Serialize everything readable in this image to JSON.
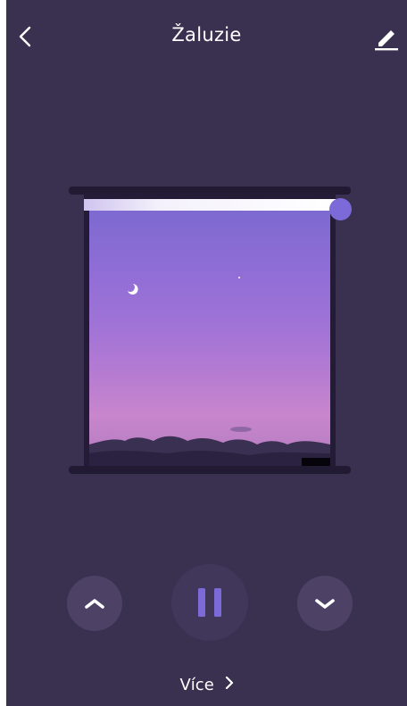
{
  "header": {
    "title": "Žaluzie"
  },
  "blind": {
    "position_fraction_closed": 0.05
  },
  "footer": {
    "more_label": "Více"
  },
  "icons": {
    "back": "chevron-left-icon",
    "edit": "pencil-icon",
    "up": "chevron-up-icon",
    "pause": "pause-icon",
    "down": "chevron-down-icon",
    "more": "chevron-right-icon"
  },
  "colors": {
    "background": "#3a3050",
    "accent": "#7c6ad8",
    "control_bg": "#4d4266"
  }
}
